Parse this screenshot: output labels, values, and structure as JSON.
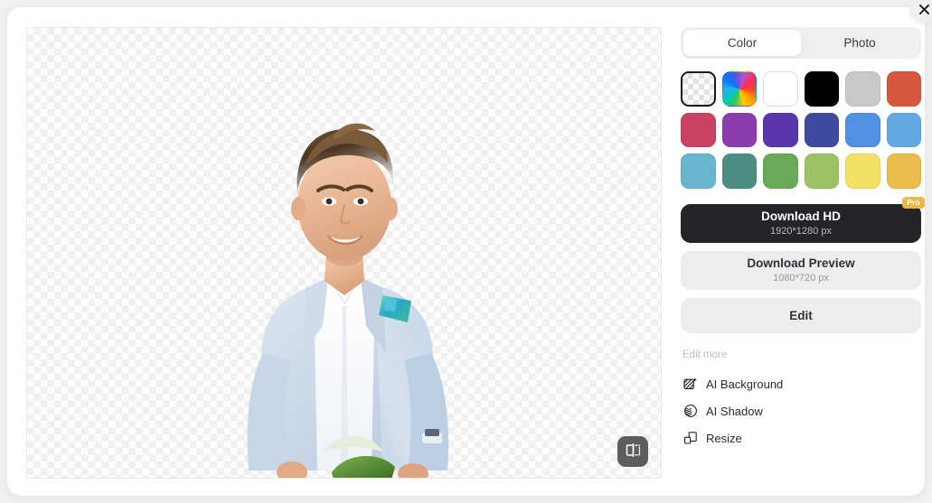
{
  "window": {
    "close_label": "✕",
    "close_icon": "close-icon"
  },
  "canvas": {
    "compare_icon": "before-after-compare-icon",
    "compare_label": "Compare",
    "background": "transparent-checkerboard",
    "subject_description": "Cut-out portrait of a smiling man in a light blue suit jacket with a teal patterned pocket square"
  },
  "panel": {
    "tabs": [
      {
        "label": "Color",
        "active": true,
        "name": "tab-color"
      },
      {
        "label": "Photo",
        "active": false,
        "name": "tab-photo"
      }
    ],
    "swatches": [
      {
        "name": "swatch-transparent",
        "type": "transparent",
        "color": "",
        "selected": true
      },
      {
        "name": "swatch-color-picker",
        "type": "picker",
        "color": "",
        "selected": false
      },
      {
        "name": "swatch-white",
        "type": "white",
        "color": "#FFFFFF",
        "selected": false
      },
      {
        "name": "swatch-black",
        "type": "solid",
        "color": "#000000",
        "selected": false
      },
      {
        "name": "swatch-light-gray",
        "type": "solid",
        "color": "#C9C9C9",
        "selected": false
      },
      {
        "name": "swatch-brick-red",
        "type": "solid",
        "color": "#D4573E",
        "selected": false
      },
      {
        "name": "swatch-crimson",
        "type": "solid",
        "color": "#CB4161",
        "selected": false
      },
      {
        "name": "swatch-purple",
        "type": "solid",
        "color": "#8B3DAE",
        "selected": false
      },
      {
        "name": "swatch-violet",
        "type": "solid",
        "color": "#5B37AE",
        "selected": false
      },
      {
        "name": "swatch-indigo",
        "type": "solid",
        "color": "#3F4A9E",
        "selected": false
      },
      {
        "name": "swatch-blue",
        "type": "solid",
        "color": "#5190E3",
        "selected": false
      },
      {
        "name": "swatch-sky-blue",
        "type": "solid",
        "color": "#62A9E4",
        "selected": false
      },
      {
        "name": "swatch-cyan",
        "type": "solid",
        "color": "#69B7CF",
        "selected": false
      },
      {
        "name": "swatch-teal",
        "type": "solid",
        "color": "#4D8E84",
        "selected": false
      },
      {
        "name": "swatch-green",
        "type": "solid",
        "color": "#69A957",
        "selected": false
      },
      {
        "name": "swatch-light-green",
        "type": "solid",
        "color": "#9CC264",
        "selected": false
      },
      {
        "name": "swatch-yellow",
        "type": "solid",
        "color": "#F3E065",
        "selected": false
      },
      {
        "name": "swatch-amber",
        "type": "solid",
        "color": "#E9BC4E",
        "selected": false
      },
      {
        "name": "swatch-orange",
        "type": "solid",
        "color": "#E49B3E",
        "selected": false
      },
      {
        "name": "swatch-burnt-orange",
        "type": "solid",
        "color": "#D9532F",
        "selected": false
      },
      {
        "name": "swatch-brown",
        "type": "solid",
        "color": "#8C7151",
        "selected": false
      },
      {
        "name": "swatch-gray",
        "type": "solid",
        "color": "#8A8A8E",
        "selected": false
      },
      {
        "name": "swatch-slate-blue",
        "type": "solid",
        "color": "#4B6B86",
        "selected": false
      },
      {
        "name": "swatch-peach",
        "type": "solid",
        "color": "#F6AC85",
        "selected": false
      }
    ],
    "download_hd": {
      "title": "Download HD",
      "subtitle": "1920*1280 px",
      "badge": "Pro",
      "badge_color": "#E9B949"
    },
    "download_preview": {
      "title": "Download Preview",
      "subtitle": "1080*720 px"
    },
    "edit_button": {
      "title": "Edit"
    },
    "edit_more": {
      "label": "Edit more",
      "items": [
        {
          "label": "AI Background",
          "icon": "ai-background-icon",
          "name": "edit-more-ai-background"
        },
        {
          "label": "AI Shadow",
          "icon": "ai-shadow-icon",
          "name": "edit-more-ai-shadow"
        },
        {
          "label": "Resize",
          "icon": "resize-icon",
          "name": "edit-more-resize"
        }
      ]
    }
  },
  "colors": {
    "accent_dark": "#232529",
    "panel_bg": "#ECEDED",
    "page_bg": "#F2F2F2",
    "muted_text": "#BCBCBC"
  }
}
